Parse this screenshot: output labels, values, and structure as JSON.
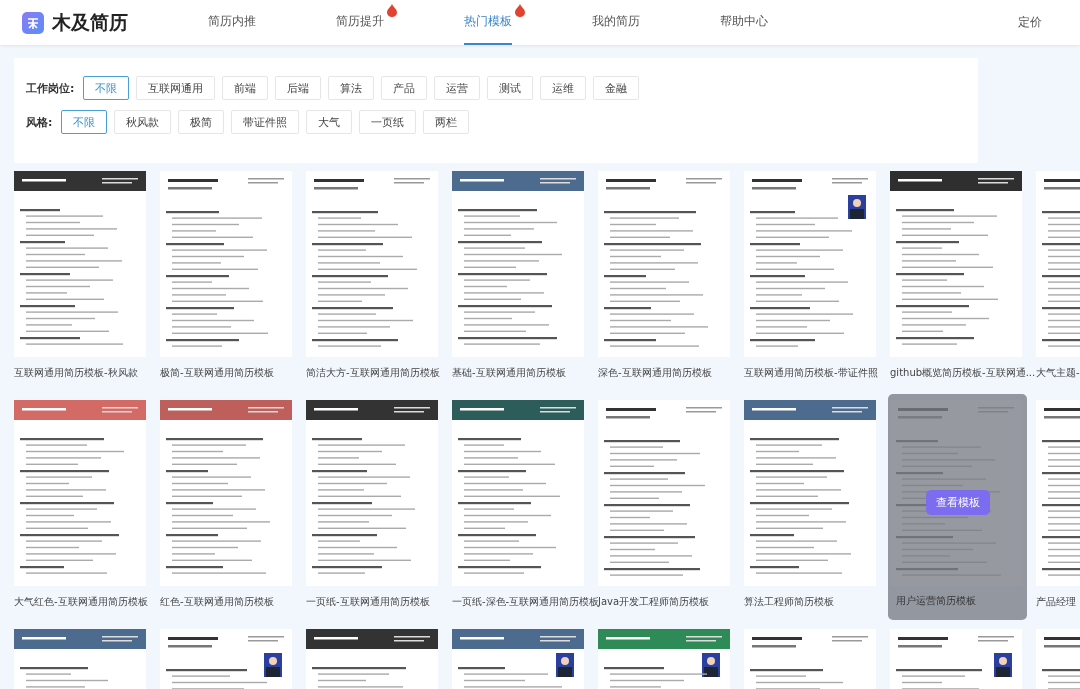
{
  "brand": {
    "name": "木及简历"
  },
  "nav": [
    {
      "label": "简历内推",
      "selected": false,
      "badge": false
    },
    {
      "label": "简历提升",
      "selected": false,
      "badge": true
    },
    {
      "label": "热门模板",
      "selected": true,
      "badge": true
    },
    {
      "label": "我的简历",
      "selected": false,
      "badge": false
    },
    {
      "label": "帮助中心",
      "selected": false,
      "badge": false
    }
  ],
  "nav_right": "定价",
  "filters": [
    {
      "label": "工作岗位:",
      "options": [
        {
          "label": "不限",
          "selected": true
        },
        {
          "label": "互联网通用",
          "selected": false
        },
        {
          "label": "前端",
          "selected": false
        },
        {
          "label": "后端",
          "selected": false
        },
        {
          "label": "算法",
          "selected": false
        },
        {
          "label": "产品",
          "selected": false
        },
        {
          "label": "运营",
          "selected": false
        },
        {
          "label": "测试",
          "selected": false
        },
        {
          "label": "运维",
          "selected": false
        },
        {
          "label": "金融",
          "selected": false
        }
      ]
    },
    {
      "label": "风格:",
      "options": [
        {
          "label": "不限",
          "selected": true
        },
        {
          "label": "秋风款",
          "selected": false
        },
        {
          "label": "极简",
          "selected": false
        },
        {
          "label": "带证件照",
          "selected": false
        },
        {
          "label": "大气",
          "selected": false
        },
        {
          "label": "一页纸",
          "selected": false
        },
        {
          "label": "两栏",
          "selected": false
        }
      ]
    }
  ],
  "templates": [
    {
      "title": "互联网通用简历模板-秋风款",
      "color": "#333333",
      "photo": false,
      "hovered": false
    },
    {
      "title": "极简-互联网通用简历模板",
      "photo": false,
      "hovered": false
    },
    {
      "title": "简洁大方-互联网通用简历模板",
      "photo": false,
      "hovered": false
    },
    {
      "title": "基础-互联网通用简历模板",
      "color": "#4d6a8f",
      "photo": false,
      "hovered": false
    },
    {
      "title": "深色-互联网通用简历模板",
      "photo": false,
      "hovered": false
    },
    {
      "title": "互联网通用简历模板-带证件照",
      "photo": true,
      "hovered": false
    },
    {
      "title": "github概览简历模板-互联网通...",
      "color": "#2f2f2f",
      "photo": false,
      "hovered": false
    },
    {
      "title": "大气主题-",
      "hovered": false
    },
    {
      "title": "大气红色-互联网通用简历模板",
      "color": "#d46a66",
      "photo": false,
      "hovered": false
    },
    {
      "title": "红色-互联网通用简历模板",
      "color": "#bf5f5c",
      "photo": false,
      "hovered": false
    },
    {
      "title": "一页纸-互联网通用简历模板",
      "color": "#333333",
      "photo": false,
      "hovered": false
    },
    {
      "title": "一页纸-深色-互联网通用简历模板",
      "color": "#2d5d5a",
      "photo": false,
      "hovered": false
    },
    {
      "title": "Java开发工程师简历模板",
      "photo": false,
      "hovered": false
    },
    {
      "title": "算法工程师简历模板",
      "color": "#4d6a8f",
      "photo": false,
      "hovered": false
    },
    {
      "title": "用户运营简历模板",
      "photo": false,
      "hovered": true,
      "overlay_button": "查看模板"
    },
    {
      "title": "产品经理",
      "hovered": false
    },
    {
      "color": "#4d6a8f",
      "photo": false,
      "hovered": false
    },
    {
      "photo": true,
      "hovered": false
    },
    {
      "color": "#333333",
      "photo": false,
      "hovered": false
    },
    {
      "color": "#4d6a8f",
      "photo": true,
      "hovered": false
    },
    {
      "color": "#2e8b57",
      "photo": true,
      "hovered": false
    },
    {
      "photo": false,
      "hovered": false
    },
    {
      "photo": true,
      "hovered": false
    },
    {
      "hovered": false
    }
  ]
}
